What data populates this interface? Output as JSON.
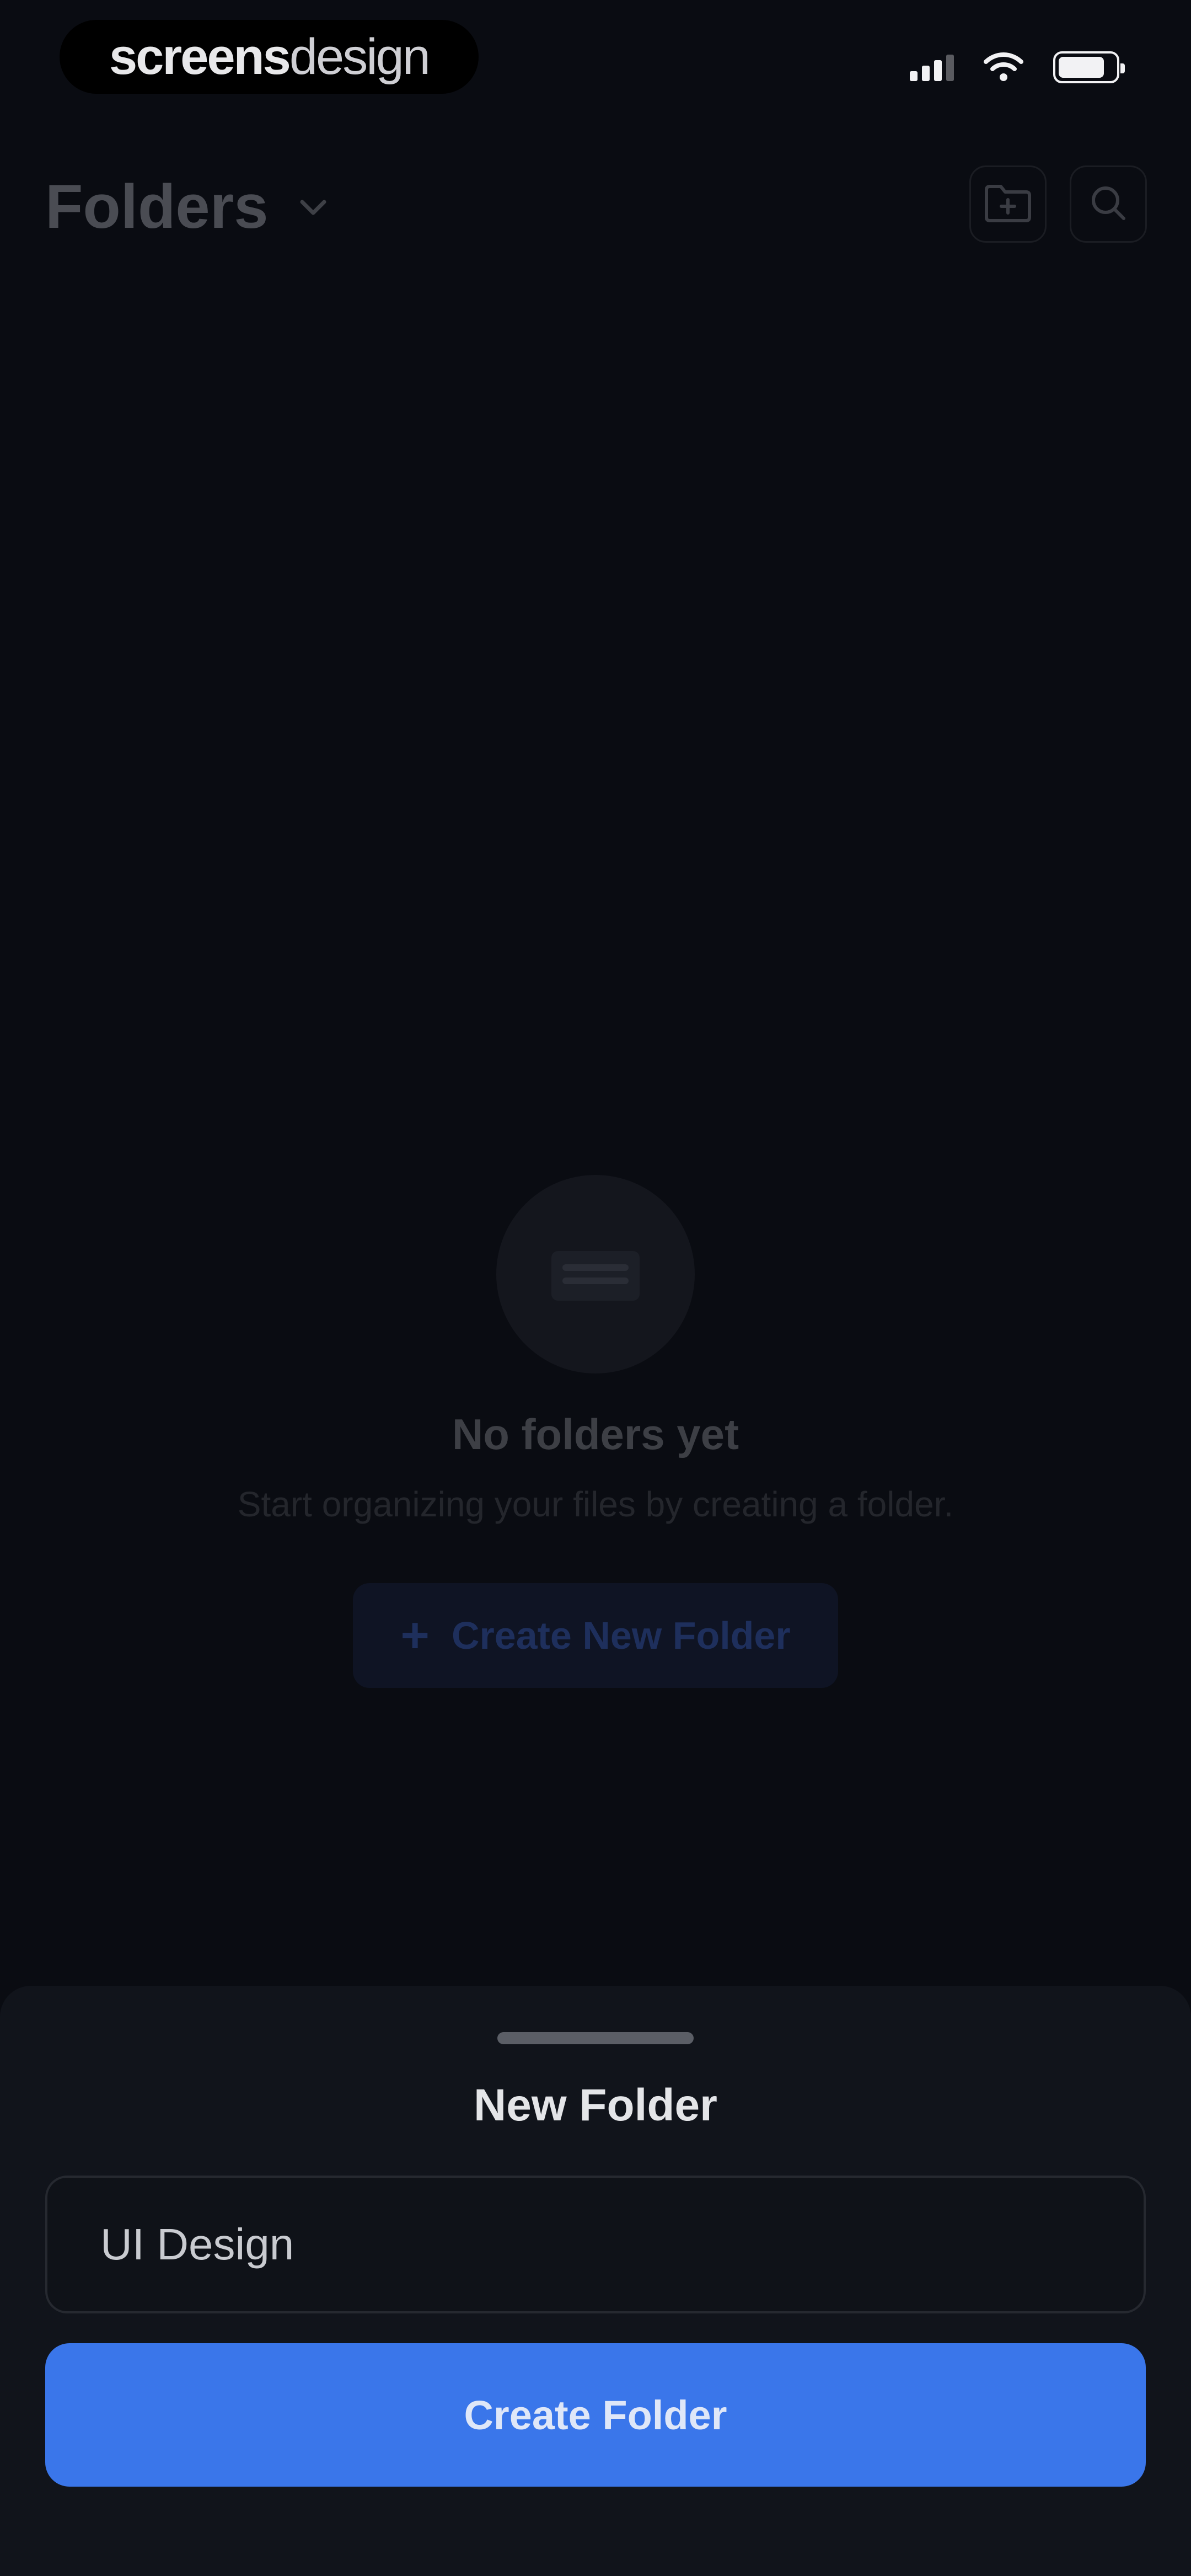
{
  "status_bar": {
    "brand_bold": "screens",
    "brand_light": "design"
  },
  "header": {
    "title": "Folders",
    "icons": [
      "chevron-down-icon",
      "folder-plus-icon",
      "search-icon"
    ]
  },
  "empty_state": {
    "title": "No folders yet",
    "subtitle": "Start organizing your files by creating a folder.",
    "cta_label": "Create New Folder",
    "cta_icon": "plus-icon"
  },
  "sheet": {
    "title": "New Folder",
    "input_value": "UI Design",
    "submit_label": "Create Folder"
  },
  "colors": {
    "background": "#0a0c12",
    "sheet": "#11141b",
    "accent": "#3a76ea"
  }
}
